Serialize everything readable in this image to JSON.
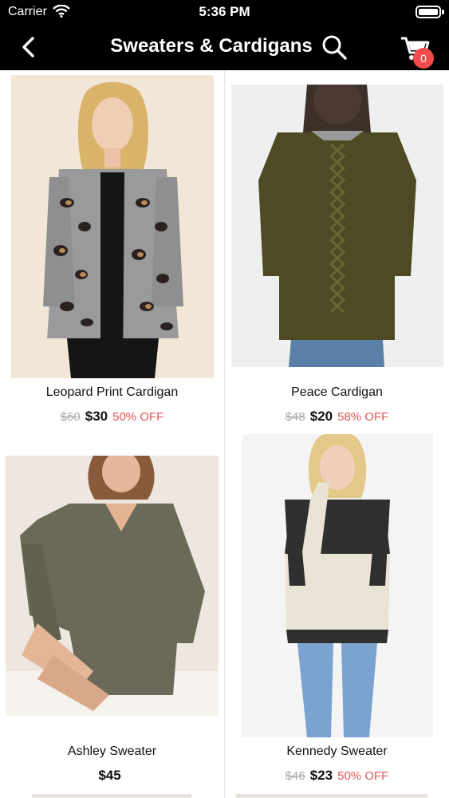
{
  "status_bar": {
    "carrier": "Carrier",
    "time": "5:36 PM"
  },
  "nav": {
    "title": "Sweaters & Cardigans",
    "cart_count": "0",
    "back_icon": "chevron-left-icon",
    "search_icon": "search-icon",
    "cart_icon": "shopping-cart-icon"
  },
  "colors": {
    "nav_bg": "#000000",
    "badge": "#f24c4c",
    "discount": "#e85252",
    "strike": "#a8a8a8"
  },
  "products": [
    {
      "name": "Leopard Print Cardigan",
      "original_price": "$60",
      "price": "$30",
      "discount": "50% OFF"
    },
    {
      "name": "Peace Cardigan",
      "original_price": "$48",
      "price": "$20",
      "discount": "58% OFF"
    },
    {
      "name": "Ashley Sweater",
      "original_price": "",
      "price": "$45",
      "discount": ""
    },
    {
      "name": "Kennedy Sweater",
      "original_price": "$46",
      "price": "$23",
      "discount": "50% OFF"
    }
  ]
}
